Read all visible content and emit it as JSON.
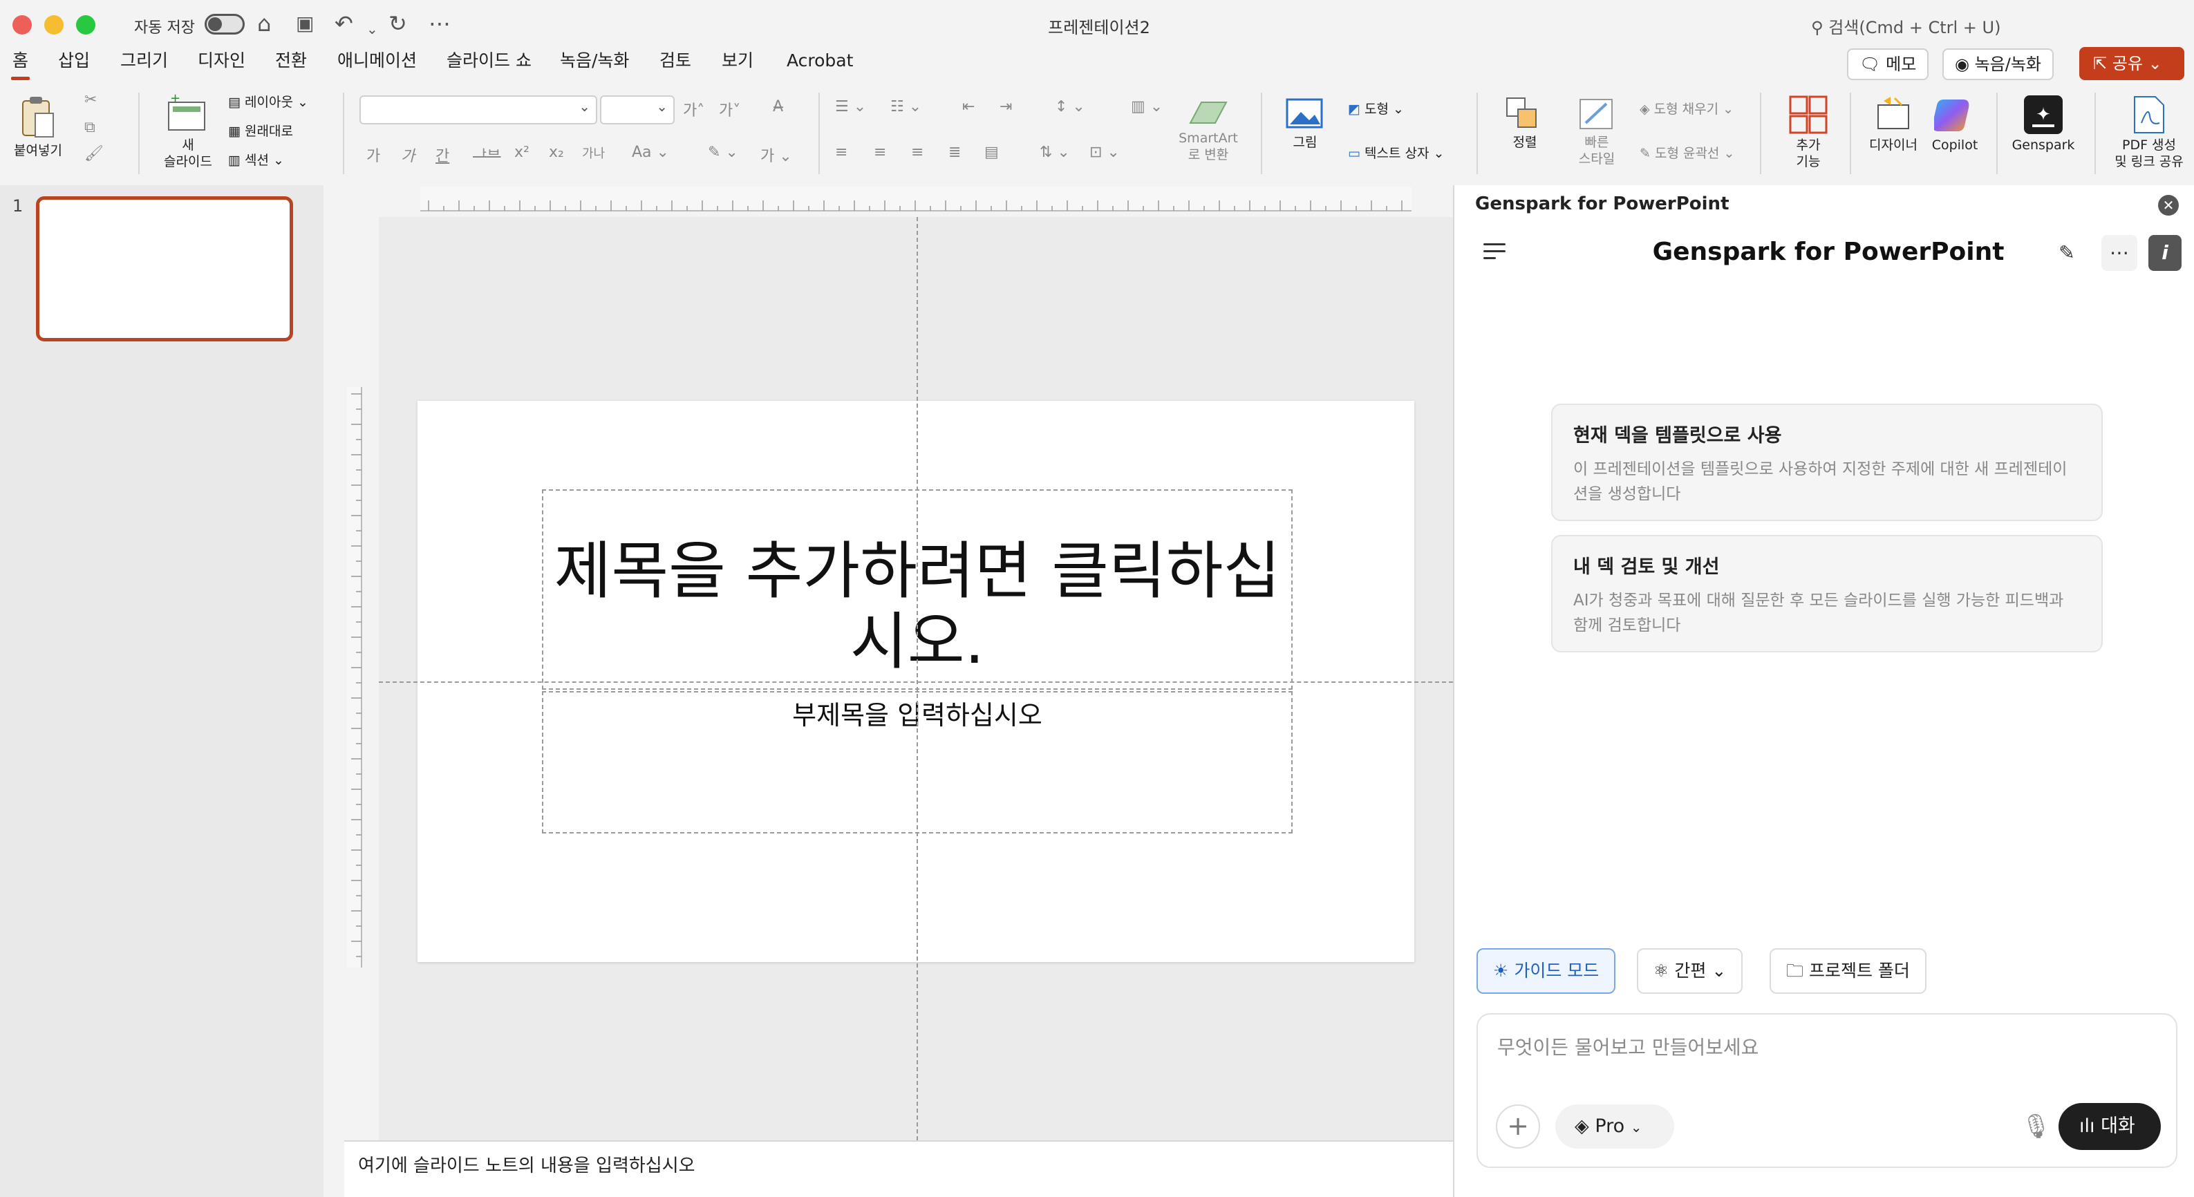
{
  "titlebar": {
    "autosave_label": "자동 저장",
    "document_title": "프레젠테이션2",
    "search_placeholder": "검색(Cmd + Ctrl + U)"
  },
  "tabs": [
    "홈",
    "삽입",
    "그리기",
    "디자인",
    "전환",
    "애니메이션",
    "슬라이드 쇼",
    "녹음/녹화",
    "검토",
    "보기",
    "Acrobat"
  ],
  "header_buttons": {
    "memo": "메모",
    "record": "녹음/녹화",
    "share": "공유"
  },
  "ribbon": {
    "paste": "붙여넣기",
    "new_slide_1": "새",
    "new_slide_2": "슬라이드",
    "layout": "레이아웃",
    "reset": "원래대로",
    "section": "섹션",
    "smartart_1": "SmartArt",
    "smartart_2": "로 변환",
    "picture": "그림",
    "shape": "도형",
    "textbox": "텍스트 상자",
    "arrange": "정렬",
    "quick_style_1": "빠른",
    "quick_style_2": "스타일",
    "shape_fill": "도형 채우기",
    "shape_outline": "도형 윤곽선",
    "addins_1": "추가",
    "addins_2": "기능",
    "designer": "디자이너",
    "copilot": "Copilot",
    "genspark": "Genspark",
    "pdf_1": "PDF 생성",
    "pdf_2": "및 링크 공유"
  },
  "thumbnail": {
    "number": "1"
  },
  "slide": {
    "title_placeholder": "제목을 추가하려면 클릭하십시오.",
    "subtitle_placeholder": "부제목을 입력하십시오"
  },
  "notes_placeholder": "여기에 슬라이드 노트의 내용을 입력하십시오",
  "pane": {
    "header": "Genspark for PowerPoint",
    "title": "Genspark for PowerPoint",
    "cards": [
      {
        "title": "현재 덱을 템플릿으로 사용",
        "desc": "이 프레젠테이션을 템플릿으로 사용하여 지정한 주제에 대한 새 프레젠테이션을 생성합니다"
      },
      {
        "title": "내 덱 검토 및 개선",
        "desc": "AI가 청중과 목표에 대해 질문한 후 모든 슬라이드를 실행 가능한 피드백과 함께 검토합니다"
      }
    ],
    "modes": {
      "guide": "가이드 모드",
      "simple": "간편",
      "project": "프로젝트 폴더"
    },
    "chat_placeholder": "무엇이든 물어보고 만들어보세요",
    "pro": "Pro",
    "talk": "대화"
  },
  "accent_color": "#c43e1c"
}
